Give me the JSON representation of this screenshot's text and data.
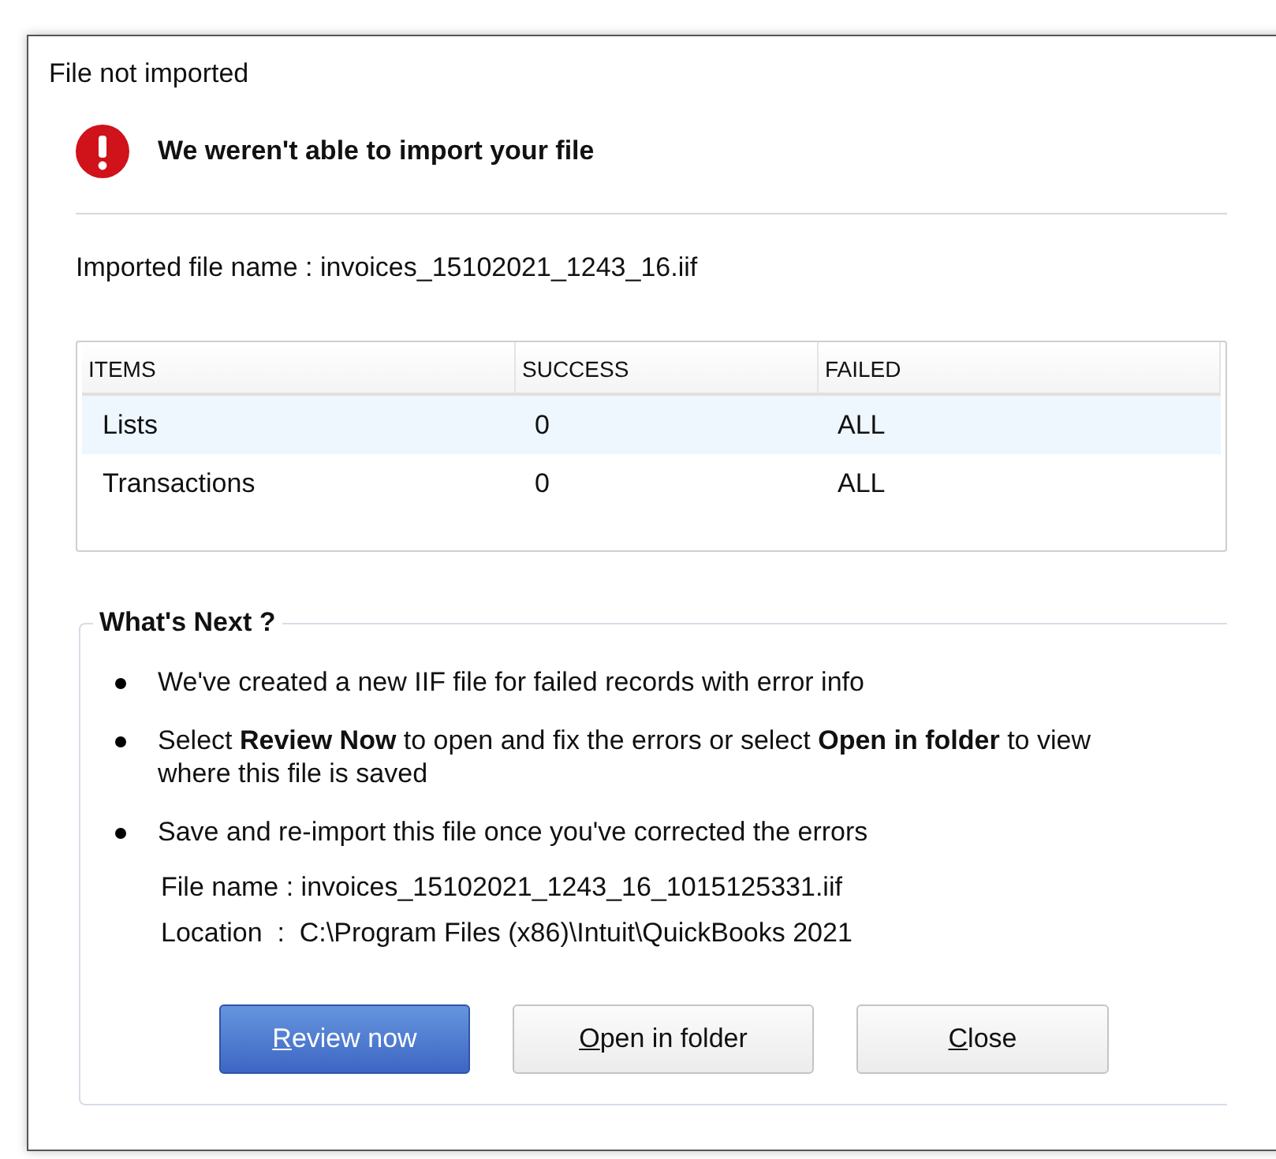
{
  "window": {
    "title": "File not imported"
  },
  "heading": "We weren't able to import your file",
  "imported_file": "Imported file name : invoices_15102021_1243_16.iif",
  "table": {
    "columns": [
      "ITEMS",
      "SUCCESS",
      "FAILED"
    ],
    "rows": [
      {
        "cells": [
          "Lists",
          "0",
          "ALL"
        ],
        "selected": true
      },
      {
        "cells": [
          "Transactions",
          "0",
          "ALL"
        ],
        "selected": false
      }
    ]
  },
  "whats_next": {
    "title": "What's Next ?",
    "bullets": [
      "We've created a new IIF file for failed records with error info",
      "Select **Review Now** to open and fix the errors or select **Open in folder** to view where this file is saved",
      "Save and re-import this file once you've corrected the errors"
    ],
    "details": [
      "File name : invoices_15102021_1243_16_1015125331.iif",
      "Location  :  C:\\Program Files (x86)\\Intuit\\QuickBooks 2021"
    ]
  },
  "buttons": [
    {
      "access_key": "R",
      "rest": "eview now",
      "default": true
    },
    {
      "access_key": "O",
      "rest": "pen in folder",
      "default": false
    },
    {
      "access_key": "C",
      "rest": "lose",
      "default": false
    }
  ]
}
